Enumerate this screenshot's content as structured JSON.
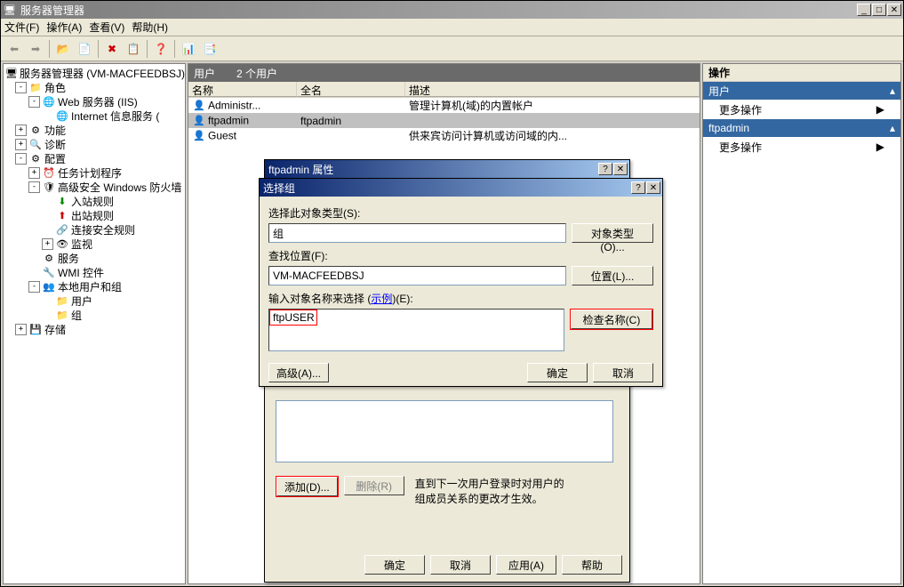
{
  "window": {
    "title": "服务器管理器"
  },
  "menu": {
    "file": "文件(F)",
    "action": "操作(A)",
    "view": "查看(V)",
    "help": "帮助(H)"
  },
  "tree": {
    "root": "服务器管理器 (VM-MACFEEDBSJ)",
    "roles": "角色",
    "web_iis": "Web 服务器 (IIS)",
    "iis_info": "Internet 信息服务 (",
    "features": "功能",
    "diagnostics": "诊断",
    "config": "配置",
    "task_sched": "任务计划程序",
    "adv_firewall": "高级安全 Windows 防火墙",
    "inbound": "入站规则",
    "outbound": "出站规则",
    "conn_sec": "连接安全规则",
    "monitor": "监视",
    "services": "服务",
    "wmi": "WMI 控件",
    "local_users": "本地用户和组",
    "users": "用户",
    "groups": "组",
    "storage": "存储"
  },
  "users_panel": {
    "title": "用户",
    "count": "2 个用户",
    "col_name": "名称",
    "col_full": "全名",
    "col_desc": "描述",
    "rows": [
      {
        "name": "Administr...",
        "full": "",
        "desc": "管理计算机(域)的内置帐户"
      },
      {
        "name": "ftpadmin",
        "full": "ftpadmin",
        "desc": ""
      },
      {
        "name": "Guest",
        "full": "",
        "desc": "供来宾访问计算机或访问域的内..."
      }
    ]
  },
  "actions": {
    "title": "操作",
    "section1": "用户",
    "more1": "更多操作",
    "section2": "ftpadmin",
    "more2": "更多操作"
  },
  "prop_dialog": {
    "title": "ftpadmin 属性",
    "add": "添加(D)...",
    "remove": "删除(R)",
    "note": "直到下一次用户登录时对用户的组成员关系的更改才生效。",
    "ok": "确定",
    "cancel": "取消",
    "apply": "应用(A)",
    "help": "帮助"
  },
  "select_dialog": {
    "title": "选择组",
    "obj_type_label": "选择此对象类型(S):",
    "obj_type_value": "组",
    "obj_type_btn": "对象类型(O)...",
    "location_label": "查找位置(F):",
    "location_value": "VM-MACFEEDBSJ",
    "location_btn": "位置(L)...",
    "names_label_pre": "输入对象名称来选择 (",
    "names_label_link": "示例",
    "names_label_post": ")(E):",
    "names_value": "ftpUSER",
    "check_btn": "检查名称(C)",
    "advanced": "高级(A)...",
    "ok": "确定",
    "cancel": "取消"
  }
}
